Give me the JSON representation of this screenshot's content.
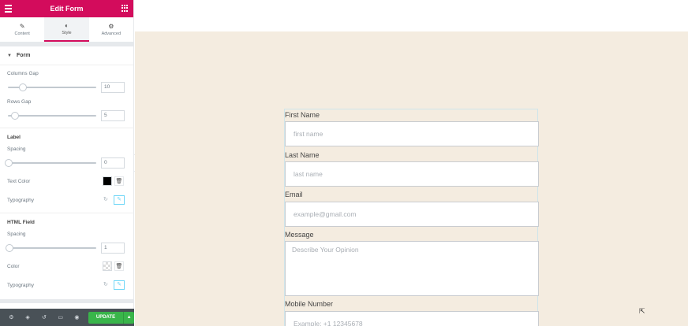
{
  "panel": {
    "title": "Edit Form",
    "tabs": [
      {
        "label": "Content",
        "icon": "pencil-icon"
      },
      {
        "label": "Style",
        "icon": "half-circle-icon"
      },
      {
        "label": "Advanced",
        "icon": "gear-icon"
      }
    ],
    "section_title": "Form",
    "columns_gap": {
      "label": "Columns Gap",
      "value": "10"
    },
    "rows_gap": {
      "label": "Rows Gap",
      "value": "5"
    },
    "label_heading": "Label",
    "label_spacing": {
      "label": "Spacing",
      "value": "0"
    },
    "text_color_label": "Text Color",
    "typography_label": "Typography",
    "html_field_heading": "HTML Field",
    "html_spacing": {
      "label": "Spacing",
      "value": "1"
    },
    "color_label": "Color",
    "html_typography_label": "Typography",
    "update_label": "UPDATE",
    "accent_color": "#d30c5c",
    "update_color": "#39b54a"
  },
  "form": {
    "fields": [
      {
        "label": "First Name",
        "placeholder": "first name"
      },
      {
        "label": "Last Name",
        "placeholder": "last name"
      },
      {
        "label": "Email",
        "placeholder": "example@gmail.com"
      },
      {
        "label": "Message",
        "placeholder": "Describe Your Opinion"
      },
      {
        "label": "Mobile Number",
        "placeholder": "Example: +1 12345678"
      }
    ],
    "background": "#f4ece0"
  }
}
